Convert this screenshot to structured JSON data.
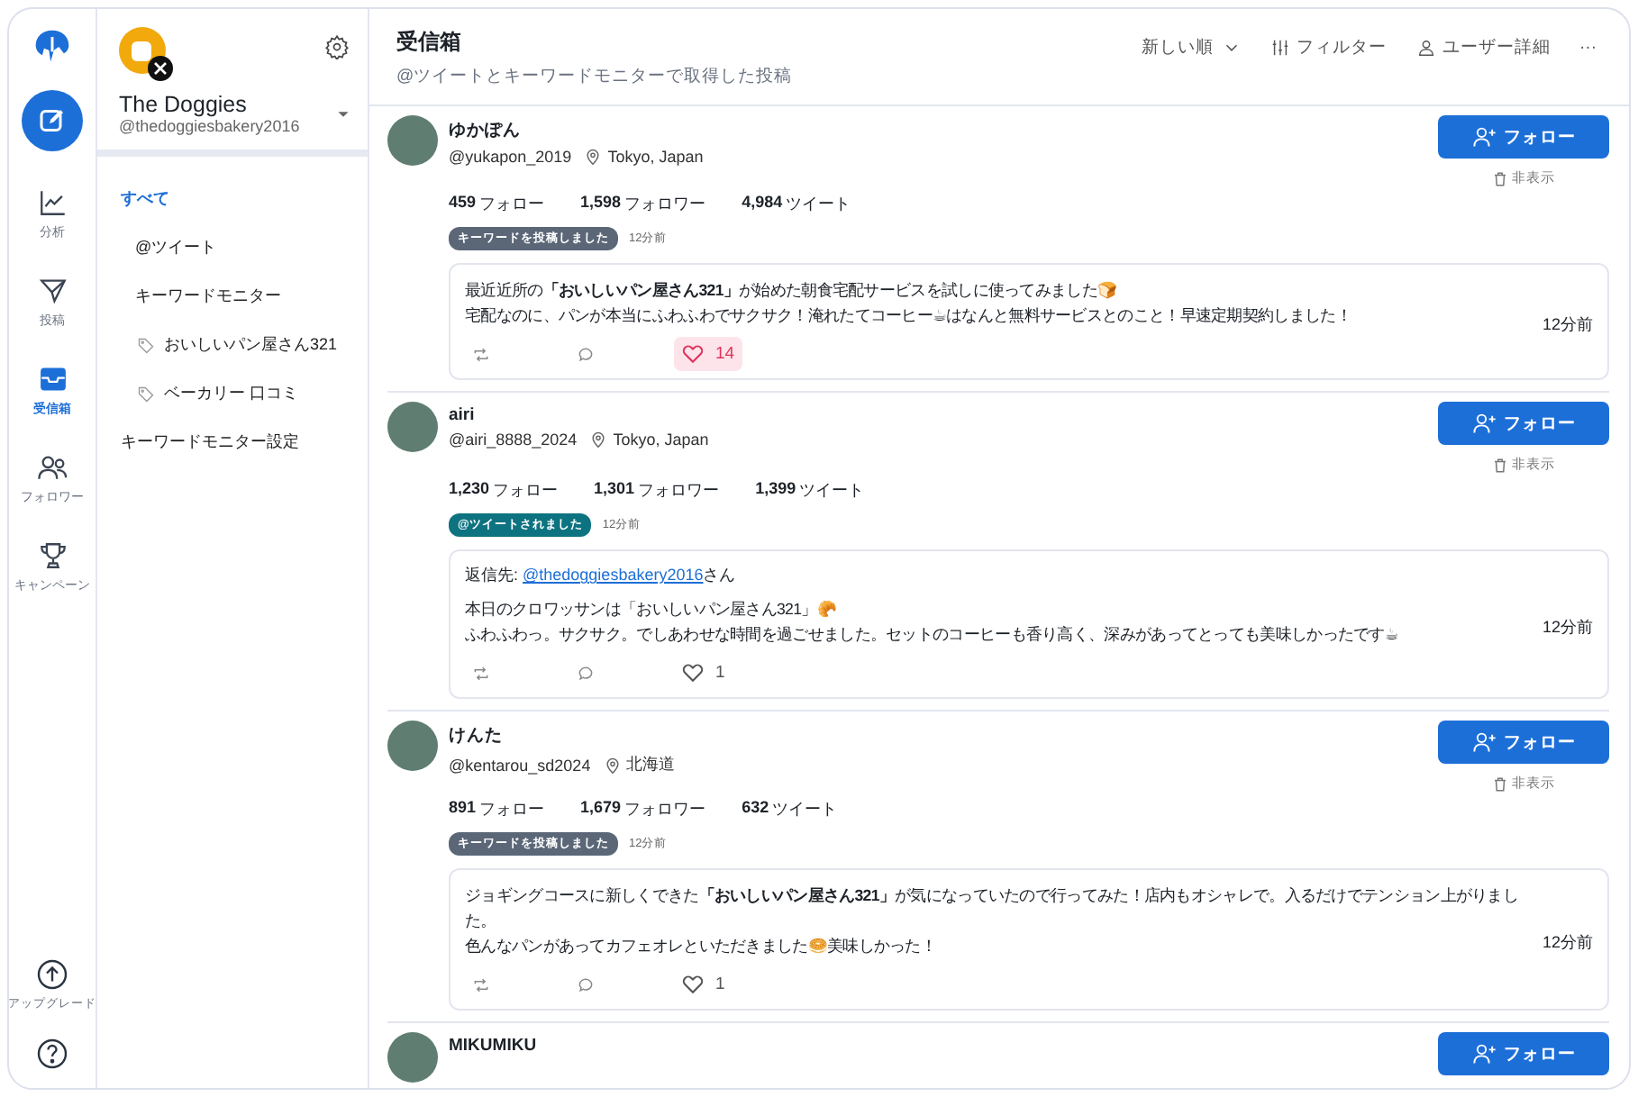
{
  "rail": {
    "compose_selected": false,
    "items": [
      {
        "label": "分析",
        "selected": false
      },
      {
        "label": "投稿",
        "selected": false
      },
      {
        "label": "受信箱",
        "selected": true
      },
      {
        "label": "フォロワー",
        "selected": false
      },
      {
        "label": "キャンペーン",
        "selected": false
      }
    ],
    "upgrade": "アップグレード"
  },
  "account": {
    "name": "The Doggies",
    "handle": "@thedoggiesbakery2016"
  },
  "menu": [
    {
      "label": "すべて",
      "selected": true,
      "children": [
        {
          "label": "@ツイート",
          "selected": false
        },
        {
          "label": "キーワードモニター",
          "selected": false,
          "children": [
            {
              "label": "おいしいパン屋さん321",
              "selected": false
            },
            {
              "label": "ベーカリー 口コミ",
              "selected": false
            }
          ]
        }
      ]
    },
    {
      "label": "キーワードモニター設定",
      "selected": false
    }
  ],
  "header": {
    "title": "受信箱",
    "subtitle": "@ツイートとキーワードモニターで取得した投稿",
    "actions": [
      "新しい順",
      "フィルター",
      "ユーザー詳細",
      "···"
    ]
  },
  "posts": [
    {
      "name": "ゆかぽん",
      "handle": "@yukapon_2019",
      "location": "Tokyo, Japan",
      "stats": [
        {
          "value": "459",
          "label": "フォロー"
        },
        {
          "value": "1,598",
          "label": "フォロワー"
        },
        {
          "value": "4,984",
          "label": "ツイート"
        }
      ],
      "follow": "フォロー",
      "hide": "非表示",
      "tag": {
        "label": "キーワードを投稿しました",
        "color": "#5b6777"
      },
      "tag_time": "12分前",
      "lines": [
        "最近近所の**「おいしいパン屋さん321」**が始めた朝食宅配サービスを試しに使ってみました🍞",
        "宅配なのに、パンが本当にふわふわでサクサク！淹れたてコーヒー☕はなんと無料サービスとのこと！早速定期契約しました！"
      ],
      "time": "12分前",
      "liked": true,
      "likes": "14"
    },
    {
      "name": "airi",
      "handle": "@airi_8888_2024",
      "location": "Tokyo, Japan",
      "stats": [
        {
          "value": "1,230",
          "label": "フォロー"
        },
        {
          "value": "1,301",
          "label": "フォロワー"
        },
        {
          "value": "1,399",
          "label": "ツイート"
        }
      ],
      "follow": "フォロー",
      "hide": "非表示",
      "tag": {
        "label": "@ツイートされました",
        "color": "#0e7380"
      },
      "tag_time": "12分前",
      "reply": {
        "prefix": "返信先: ",
        "handle": "@thedoggiesbakery2016",
        "suffix": "さん"
      },
      "lines": [
        "本日のクロワッサンは「おいしいパン屋さん321」🥐",
        "ふわふわっ。サクサク。でしあわせな時間を過ごせました。セットのコーヒーも香り高く、深みがあってとっても美味しかったです☕"
      ],
      "time": "12分前",
      "liked": false,
      "likes": "1"
    },
    {
      "name": "けんた",
      "handle": "@kentarou_sd2024",
      "location": "北海道",
      "stats": [
        {
          "value": "891",
          "label": "フォロー"
        },
        {
          "value": "1,679",
          "label": "フォロワー"
        },
        {
          "value": "632",
          "label": "ツイート"
        }
      ],
      "follow": "フォロー",
      "hide": "非表示",
      "tag": {
        "label": "キーワードを投稿しました",
        "color": "#5b6777"
      },
      "tag_time": "12分前",
      "lines": [
        "ジョギングコースに新しくできた**「おいしいパン屋さん321」**が気になっていたので行ってみた！店内もオシャレで。入るだけでテンション上がりました。",
        "色んなパンがあってカフェオレといただきました🥯美味しかった！"
      ],
      "time": "12分前",
      "liked": false,
      "likes": "1"
    },
    {
      "name": "MIKUMIKU",
      "follow": "フォロー"
    }
  ]
}
